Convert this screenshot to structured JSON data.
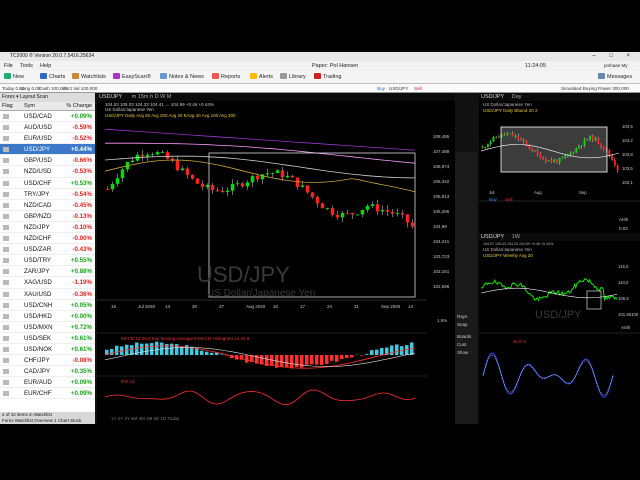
{
  "window": {
    "title": "TC2000 ® Version 20.0.7.5416.25634",
    "controls": "–  □  ×"
  },
  "menu": {
    "file": "File",
    "tools": "Tools",
    "help": "Help",
    "account": "Paper: Pol Hansen",
    "clock": "11:24:05",
    "user": "pmhaan My Settings"
  },
  "toolbar": {
    "new": "New",
    "charts": "Charts",
    "watchlists": "Watchlists",
    "easyscan": "EasyScan®",
    "notes": "Notes & News",
    "reports": "Reports",
    "alerts": "Alerts",
    "library": "Library",
    "trading": "Trading",
    "messages": "Messages"
  },
  "status": {
    "today": "Today 0.00",
    "long": "Long 0.00",
    "cash": "Cash 100,000",
    "acct": "Acct Val 100,000",
    "buy": "Buy",
    "symbol": "USD/JPY",
    "sell": "Sell",
    "buying_power": "Simulated Buying Power 200,000"
  },
  "watchlist": {
    "tools_label": "Forex ▾  Layout  Scan",
    "col_flag": "Flag",
    "col_sym": "Sym",
    "col_chg": "% Change",
    "rows": [
      {
        "sym": "USD/CAD",
        "chg": "+0.09%",
        "dir": "pos"
      },
      {
        "sym": "AUD/USD",
        "chg": "-0.59%",
        "dir": "neg"
      },
      {
        "sym": "EUR/USD",
        "chg": "-0.52%",
        "dir": "neg"
      },
      {
        "sym": "USD/JPY",
        "chg": "+0.44%",
        "dir": "pos",
        "selected": true
      },
      {
        "sym": "GBP/USD",
        "chg": "-0.66%",
        "dir": "neg"
      },
      {
        "sym": "NZD/USD",
        "chg": "-0.53%",
        "dir": "neg"
      },
      {
        "sym": "USD/CHF",
        "chg": "+0.53%",
        "dir": "pos"
      },
      {
        "sym": "TRY/JPY",
        "chg": "-0.54%",
        "dir": "neg"
      },
      {
        "sym": "NZD/CAD",
        "chg": "-0.45%",
        "dir": "neg"
      },
      {
        "sym": "GBP/NZD",
        "chg": "-0.13%",
        "dir": "neg"
      },
      {
        "sym": "NZD/JPY",
        "chg": "-0.10%",
        "dir": "neg"
      },
      {
        "sym": "NZD/CHF",
        "chg": "-0.00%",
        "dir": "neg"
      },
      {
        "sym": "USD/ZAR",
        "chg": "-0.43%",
        "dir": "neg"
      },
      {
        "sym": "USD/TRY",
        "chg": "+0.55%",
        "dir": "pos"
      },
      {
        "sym": "ZAR/JPY",
        "chg": "+0.88%",
        "dir": "pos"
      },
      {
        "sym": "XAG/USD",
        "chg": "-1.19%",
        "dir": "neg"
      },
      {
        "sym": "XAU/USD",
        "chg": "-0.36%",
        "dir": "neg"
      },
      {
        "sym": "USD/CNH",
        "chg": "+0.05%",
        "dir": "pos"
      },
      {
        "sym": "USD/HKD",
        "chg": "+0.00%",
        "dir": "pos"
      },
      {
        "sym": "USD/MXN",
        "chg": "+0.72%",
        "dir": "pos"
      },
      {
        "sym": "USD/SEK",
        "chg": "+0.61%",
        "dir": "pos"
      },
      {
        "sym": "USD/NOK",
        "chg": "+0.61%",
        "dir": "pos"
      },
      {
        "sym": "CHF/JPY",
        "chg": "-0.08%",
        "dir": "neg"
      },
      {
        "sym": "CAD/JPY",
        "chg": "+0.35%",
        "dir": "pos"
      },
      {
        "sym": "EUR/AUD",
        "chg": "+0.09%",
        "dir": "pos"
      },
      {
        "sym": "EUR/CHF",
        "chg": "+0.09%",
        "dir": "pos"
      }
    ],
    "footer": "4 of 42 items in Watchlist",
    "tabs": "Forex   Watchlist   Overview   1 Chart   Stock"
  },
  "main_chart": {
    "symbol": "USD/JPY",
    "timeframes": "m  15m  h  D  W  M",
    "quote": "104.53 105.03 104.33 104.41 → 104.99 +0.46 +0.44%",
    "name": "US Dollar/Japanese Yen",
    "watermark_sym": "USD/JPY",
    "watermark_name": "US Dollar/Japanese Yen",
    "overlays": "USD/JPY Daily   Avg 60   Avg 200   Avg 20   EAvg 40   Avg 100   Avg 300",
    "price_ticks": [
      "108,485",
      "107,489",
      "106,974",
      "106,342",
      "105,813",
      "105,286",
      "104,99",
      "104,241",
      "103,723",
      "103,161",
      "102,686"
    ],
    "date_ticks": [
      "15",
      "Jul 2020",
      "13",
      "20",
      "27",
      "Aug 2020",
      "10",
      "17",
      "24",
      "31",
      "Sep 2020",
      "14"
    ],
    "pct": "1.5%",
    "macd_label": "MACD 12 26 9    Exp Moving Average 9    MACD Histogram 12 26 9",
    "rsi_label": "RSI 14",
    "tf_bar": "1Y  2Y  3Y  6M  3M  1M  5D  1D  Today"
  },
  "side_tools": [
    "Rays",
    "Snap",
    "Boards",
    "Cust",
    "Show"
  ],
  "top_right_chart": {
    "symbol": "USD/JPY",
    "tf": "Day",
    "quote": "104.99",
    "name": "US Dollar/Japanese Yen",
    "overlay": "USD/JPY Daily   Bband 20 2",
    "ticks": [
      "104,5",
      "104,2",
      "103,8",
      "103,5",
      "103,1"
    ],
    "months": [
      "Jul",
      "Aug",
      "Sep"
    ],
    "buy": "Buy",
    "sell": "Sell",
    "arith": "Arith",
    "val": "0.03"
  },
  "bottom_right_chart": {
    "symbol": "USD/JPY",
    "tf": "1W",
    "quote": "104.57 105.03 104.33 104.99 +0.46 +0.44%",
    "name": "US Dollar/Japanese Yen",
    "overlay": "USD/JPY Weekly   Avg 20",
    "watermark": "USD/JPY",
    "ticks": [
      "115,0",
      "110,0",
      "106,5",
      "101,55100"
    ],
    "stoch": "SLO 3",
    "arith": "Arith"
  },
  "colors": {
    "bull": "#00dd00",
    "bear": "#ff2020",
    "wick": "#dddddd"
  }
}
